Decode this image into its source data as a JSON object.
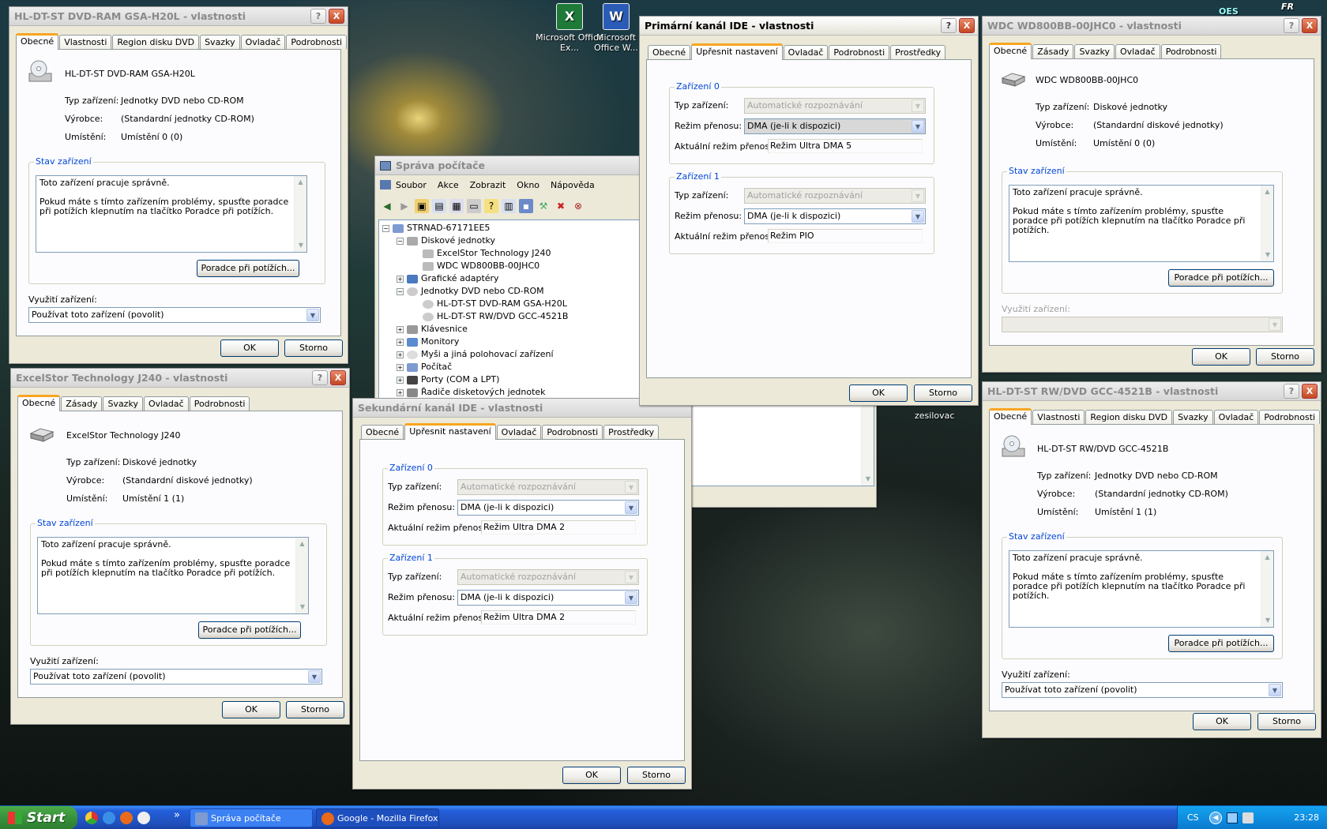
{
  "desktop": {
    "icons": [
      {
        "label": "Microsoft Office Ex...",
        "glyph": "X",
        "color": "#1f7a3a"
      },
      {
        "label": "Microsoft Office W...",
        "glyph": "W",
        "color": "#2a5bb7"
      }
    ],
    "note_label": "zesilovac",
    "corner_badges": [
      "OES",
      "FR"
    ]
  },
  "common": {
    "tab_general": "Obecné",
    "tab_properties": "Vlastnosti",
    "tab_region": "Region disku DVD",
    "tab_volumes": "Svazky",
    "tab_driver": "Ovladač",
    "tab_details": "Podrobnosti",
    "tab_policies": "Zásady",
    "tab_advanced": "Upřesnit nastavení",
    "tab_resources": "Prostředky",
    "lbl_type": "Typ zařízení:",
    "lbl_maker": "Výrobce:",
    "lbl_location": "Umístění:",
    "lbl_status": "Stav zařízení",
    "lbl_usage": "Využití zařízení:",
    "status_line1": "Toto zařízení pracuje správně.",
    "status_line2": "Pokud máte s tímto zařízením problémy, spusťte poradce při potížích klepnutím na tlačítko Poradce při potížích.",
    "troubleshoot": "Poradce při potížích...",
    "ok": "OK",
    "cancel": "Storno",
    "help": "?",
    "close": "X",
    "usage_value": "Používat toto zařízení (povolit)",
    "dev0": "Zařízení 0",
    "dev1": "Zařízení 1",
    "lbl_devtype": "Typ zařízení:",
    "lbl_transfer": "Režim přenosu:",
    "lbl_current": "Aktuální režim přenosu:",
    "auto_detect": "Automatické rozpoznávání",
    "dma": "DMA (je-li k dispozici)"
  },
  "w1": {
    "title": "HL-DT-ST DVD-RAM GSA-H20L - vlastnosti",
    "name": "HL-DT-ST DVD-RAM GSA-H20L",
    "type": "Jednotky DVD nebo CD-ROM",
    "maker": "(Standardní jednotky CD-ROM)",
    "location": "Umístění 0 (0)"
  },
  "w2": {
    "title": "ExcelStor Technology J240 - vlastnosti",
    "name": "ExcelStor Technology J240",
    "type": "Diskové jednotky",
    "maker": "(Standardní diskové jednotky)",
    "location": "Umístění 1 (1)"
  },
  "w3": {
    "title": "Správa počítače",
    "menu": [
      "Soubor",
      "Akce",
      "Zobrazit",
      "Okno",
      "Nápověda"
    ],
    "tree": [
      "STRNAD-67171EE5",
      "Diskové jednotky",
      "ExcelStor Technology J240",
      "WDC WD800BB-00JHC0",
      "Grafické adaptéry",
      "Jednotky DVD nebo CD-ROM",
      "HL-DT-ST DVD-RAM GSA-H20L",
      "HL-DT-ST RW/DVD GCC-4521B",
      "Klávesnice",
      "Monitory",
      "Myši a jiná polohovací zařízení",
      "Počítač",
      "Porty (COM a LPT)",
      "Řadiče disketových jednotek"
    ]
  },
  "w4": {
    "title": "Sekundární kanál IDE - vlastnosti",
    "cur0": "Režim Ultra DMA 2",
    "cur1": "Režim Ultra DMA 2"
  },
  "w5": {
    "title": "Primární kanál IDE - vlastnosti",
    "cur0": "Režim Ultra DMA 5",
    "cur1": "Režim PIO"
  },
  "w6": {
    "title": "WDC WD800BB-00JHC0 - vlastnosti",
    "name": "WDC WD800BB-00JHC0",
    "type": "Diskové jednotky",
    "maker": "(Standardní diskové jednotky)",
    "location": "Umístění 0 (0)"
  },
  "w7": {
    "title": "HL-DT-ST RW/DVD GCC-4521B - vlastnosti",
    "name": "HL-DT-ST RW/DVD GCC-4521B",
    "type": "Jednotky DVD nebo CD-ROM",
    "maker": "(Standardní jednotky CD-ROM)",
    "location": "Umístění 1 (1)"
  },
  "taskbar": {
    "start": "Start",
    "chevron": "»",
    "tasks": [
      "Správa počítače",
      "Google - Mozilla Firefox"
    ],
    "tray_lang": "CS",
    "clock": "23:28"
  }
}
